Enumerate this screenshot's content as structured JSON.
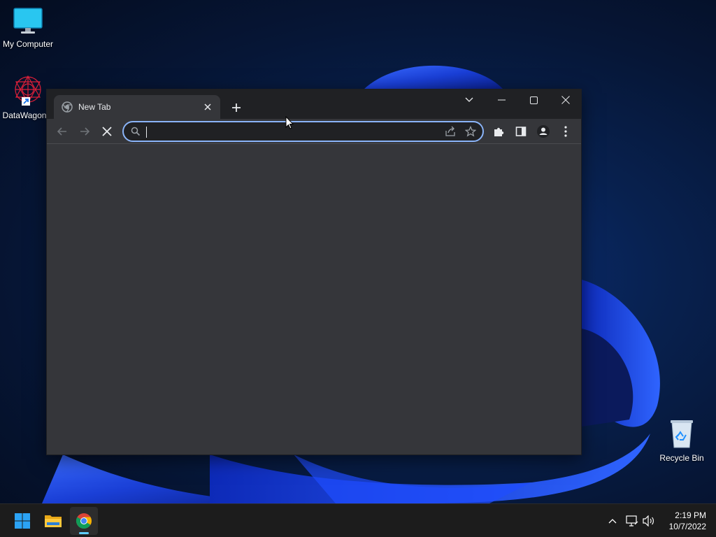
{
  "desktop": {
    "icons": [
      {
        "label": "My Computer",
        "icon": "monitor-icon"
      },
      {
        "label": "DataWagon...",
        "icon": "datawagon-icon"
      },
      {
        "label": "Recycle Bin",
        "icon": "recycle-bin-icon"
      }
    ]
  },
  "browser": {
    "tab": {
      "title": "New Tab",
      "favicon": "chrome-dark-icon"
    },
    "window_controls": [
      "tab-search",
      "minimize",
      "maximize",
      "close"
    ],
    "toolbar": {
      "back": "arrow-left-icon",
      "forward": "arrow-right-icon",
      "stop": "x-icon",
      "omnibox": {
        "value": "",
        "placeholder": ""
      },
      "extensions": "puzzle-icon",
      "side_panel": "side-panel-icon",
      "profile": "person-icon",
      "menu": "kebab-icon"
    }
  },
  "taskbar": {
    "apps": [
      "start",
      "file-explorer",
      "google-chrome"
    ],
    "clock": {
      "time": "2:19 PM",
      "date": "10/7/2022"
    }
  },
  "colors": {
    "accent": "#8ab4f8",
    "tab_strip": "#202124",
    "toolbar": "#35363a",
    "taskbar": "#1c1c1c",
    "running_indicator": "#60cdff"
  }
}
